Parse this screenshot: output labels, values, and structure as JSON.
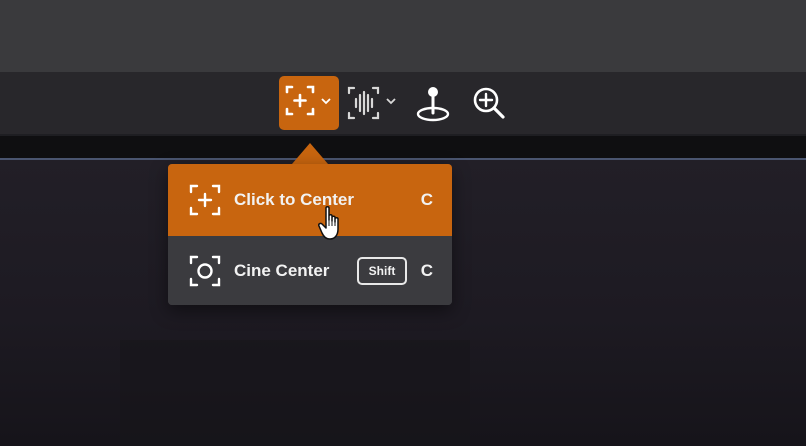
{
  "toolbar": {
    "buttons": [
      {
        "icon": "center-target-icon",
        "has_dropdown": true,
        "active": true
      },
      {
        "icon": "audio-waveform-icon",
        "has_dropdown": true,
        "active": false
      },
      {
        "icon": "map-pin-icon",
        "has_dropdown": false,
        "active": false
      },
      {
        "icon": "zoom-in-icon",
        "has_dropdown": false,
        "active": false
      }
    ]
  },
  "dropdown": {
    "items": [
      {
        "label": "Click to Center",
        "shortcut": "C",
        "icon": "click-to-center-icon",
        "highlighted": true
      },
      {
        "label": "Cine Center",
        "modifier": "Shift",
        "shortcut": "C",
        "icon": "cine-center-icon",
        "highlighted": false
      }
    ]
  },
  "colors": {
    "accent": "#c8650f",
    "menu_bg": "#3b3b3f",
    "toolbar_bg": "#28272b",
    "top_bg": "#3a3a3d"
  }
}
